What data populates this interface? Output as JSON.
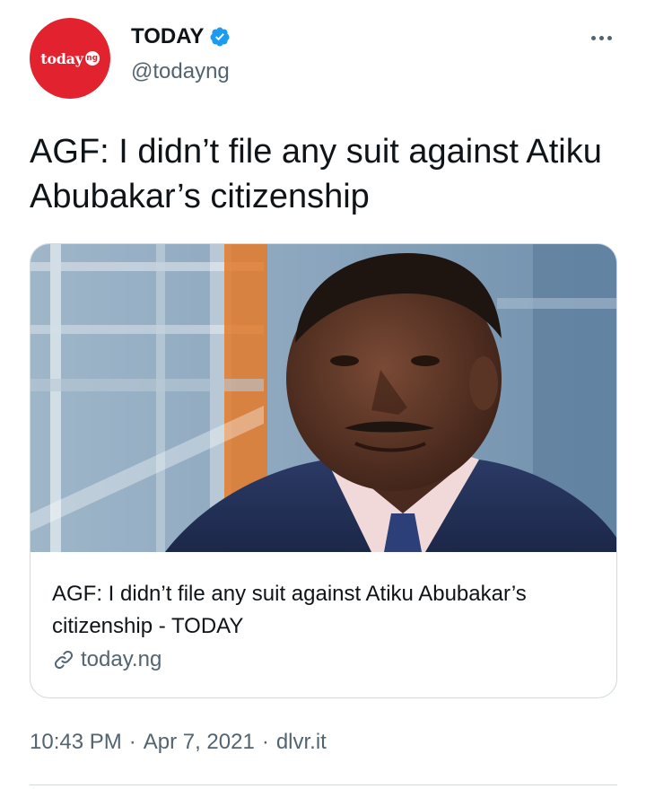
{
  "author": {
    "avatar_word": "today",
    "avatar_suffix": "ng",
    "name": "TODAY",
    "handle": "@todayng",
    "verified": true
  },
  "tweet": {
    "text": "AGF: I didn’t file any suit against Atiku Abubakar’s citizenship"
  },
  "card": {
    "title": "AGF: I didn’t file any suit against Atiku Abubakar’s citizenship - TODAY",
    "domain": "today.ng"
  },
  "meta": {
    "time": "10:43 PM",
    "separator": "·",
    "date": "Apr 7, 2021",
    "source": "dlvr.it"
  },
  "colors": {
    "brand_red": "#e2232f",
    "verified_blue": "#1d9bf0",
    "text_primary": "#0f1419",
    "text_secondary": "#536471",
    "border": "#cfd9de"
  },
  "icons": {
    "verified": "verified-badge-icon",
    "more": "more-options-icon",
    "link": "link-icon"
  }
}
